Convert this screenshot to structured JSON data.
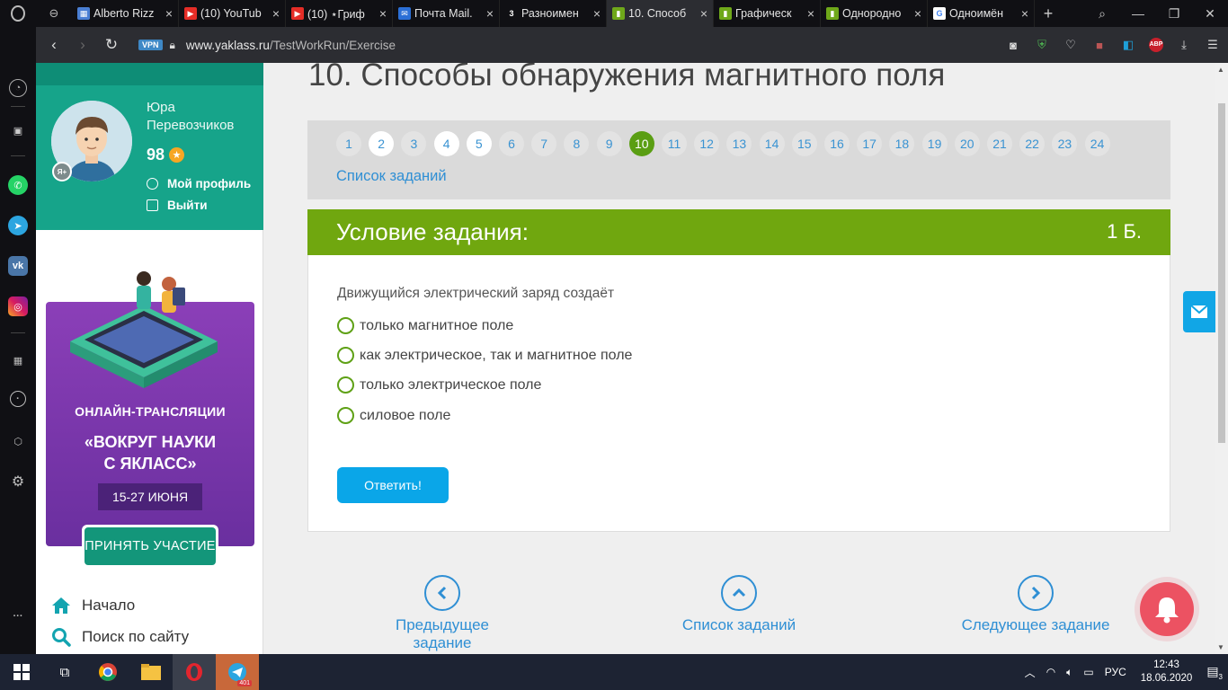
{
  "browser": {
    "tabs": [
      {
        "title": "Alberto Rizz",
        "color": "#4a7fd4",
        "glyph": "▦"
      },
      {
        "title": "(10) YouTub",
        "color": "#e52d27",
        "glyph": "▶"
      },
      {
        "title": "(10) ⋆Гриф",
        "color": "#e52d27",
        "glyph": "▶"
      },
      {
        "title": "Почта Mail.",
        "color": "#2b6fd6",
        "glyph": "✉"
      },
      {
        "title": "Разноимен",
        "color": "#101014",
        "glyph": "3"
      },
      {
        "title": "10. Способ",
        "color": "#6fa81a",
        "glyph": "▮",
        "active": true
      },
      {
        "title": "Графическ",
        "color": "#6fa81a",
        "glyph": "▮"
      },
      {
        "title": "Однородно",
        "color": "#6fa81a",
        "glyph": "▮"
      },
      {
        "title": "Одноимён",
        "color": "#ffffff",
        "glyph": "G"
      }
    ],
    "vpn_label": "VPN",
    "url_host": "www.yaklass.ru",
    "url_path": "/TestWorkRun/Exercise",
    "abp_label": "ABP"
  },
  "profile": {
    "first_name": "Юра",
    "last_name": "Перевозчиков",
    "points": "98",
    "badge": "Я+",
    "my_profile": "Мой профиль",
    "logout": "Выйти"
  },
  "promo": {
    "line1": "ОНЛАЙН-ТРАНСЛЯЦИИ",
    "line2": "«ВОКРУГ НАУКИ",
    "line3": "С ЯКЛАСС»",
    "dates": "15-27 ИЮНЯ",
    "button": "ПРИНЯТЬ УЧАСТИЕ"
  },
  "sitenav": {
    "home": "Начало",
    "search": "Поиск по сайту"
  },
  "page": {
    "title": "10. Способы обнаружения магнитного поля",
    "numbers": [
      "1",
      "2",
      "3",
      "4",
      "5",
      "6",
      "7",
      "8",
      "9",
      "10",
      "11",
      "12",
      "13",
      "14",
      "15",
      "16",
      "17",
      "18",
      "19",
      "20",
      "21",
      "22",
      "23",
      "24"
    ],
    "done_numbers": [
      "2",
      "4",
      "5"
    ],
    "current": "10",
    "task_list_link": "Список заданий",
    "condition_title": "Условие задания:",
    "score": "1 Б.",
    "question": "Движущийся электрический заряд создаёт",
    "options": [
      "только магнитное поле",
      "как электрическое, так и магнитное поле",
      "только электрическое поле",
      "силовое поле"
    ],
    "answer_button": "Ответить!",
    "prev": "Предыдущее задание",
    "list": "Список заданий",
    "next": "Следующее задание"
  },
  "taskbar": {
    "telegram_badge": "401",
    "lang": "РУС",
    "time": "12:43",
    "date": "18.06.2020",
    "notif_count": "3"
  }
}
